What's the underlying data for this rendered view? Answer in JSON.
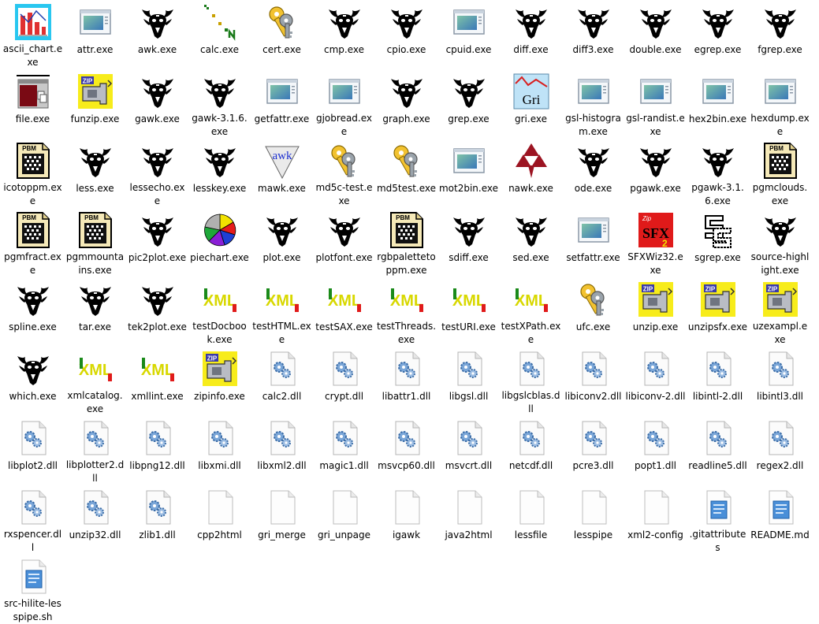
{
  "files": [
    {
      "name": "ascii_chart.exe",
      "icon": "ascii-chart-icon"
    },
    {
      "name": "attr.exe",
      "icon": "app-window-icon"
    },
    {
      "name": "awk.exe",
      "icon": "gnu-icon"
    },
    {
      "name": "calc.exe",
      "icon": "calc-icon"
    },
    {
      "name": "cert.exe",
      "icon": "keys-icon"
    },
    {
      "name": "cmp.exe",
      "icon": "gnu-icon"
    },
    {
      "name": "cpio.exe",
      "icon": "gnu-icon"
    },
    {
      "name": "cpuid.exe",
      "icon": "app-window-icon"
    },
    {
      "name": "diff.exe",
      "icon": "gnu-icon"
    },
    {
      "name": "diff3.exe",
      "icon": "gnu-icon"
    },
    {
      "name": "double.exe",
      "icon": "gnu-icon"
    },
    {
      "name": "egrep.exe",
      "icon": "gnu-icon"
    },
    {
      "name": "fgrep.exe",
      "icon": "gnu-icon"
    },
    {
      "name": "file.exe",
      "icon": "file-tool-icon"
    },
    {
      "name": "funzip.exe",
      "icon": "zip-icon"
    },
    {
      "name": "gawk.exe",
      "icon": "gnu-icon"
    },
    {
      "name": "gawk-3.1.6.exe",
      "icon": "gnu-icon"
    },
    {
      "name": "getfattr.exe",
      "icon": "app-window-icon"
    },
    {
      "name": "gjobread.exe",
      "icon": "app-window-icon"
    },
    {
      "name": "graph.exe",
      "icon": "gnu-icon"
    },
    {
      "name": "grep.exe",
      "icon": "gnu-icon"
    },
    {
      "name": "gri.exe",
      "icon": "gri-icon"
    },
    {
      "name": "gsl-histogram.exe",
      "icon": "app-window-icon"
    },
    {
      "name": "gsl-randist.exe",
      "icon": "app-window-icon"
    },
    {
      "name": "hex2bin.exe",
      "icon": "app-window-icon"
    },
    {
      "name": "hexdump.exe",
      "icon": "app-window-icon"
    },
    {
      "name": "icotoppm.exe",
      "icon": "pbm-icon"
    },
    {
      "name": "less.exe",
      "icon": "gnu-icon"
    },
    {
      "name": "lessecho.exe",
      "icon": "gnu-icon"
    },
    {
      "name": "lesskey.exe",
      "icon": "gnu-icon"
    },
    {
      "name": "mawk.exe",
      "icon": "mawk-icon"
    },
    {
      "name": "md5c-test.exe",
      "icon": "keys-icon"
    },
    {
      "name": "md5test.exe",
      "icon": "keys-icon"
    },
    {
      "name": "mot2bin.exe",
      "icon": "app-window-icon"
    },
    {
      "name": "nawk.exe",
      "icon": "nawk-icon"
    },
    {
      "name": "ode.exe",
      "icon": "gnu-icon"
    },
    {
      "name": "pgawk.exe",
      "icon": "gnu-icon"
    },
    {
      "name": "pgawk-3.1.6.exe",
      "icon": "gnu-icon"
    },
    {
      "name": "pgmclouds.exe",
      "icon": "pbm-icon"
    },
    {
      "name": "pgmfract.exe",
      "icon": "pbm-icon"
    },
    {
      "name": "pgmmountains.exe",
      "icon": "pbm-icon"
    },
    {
      "name": "pic2plot.exe",
      "icon": "gnu-icon"
    },
    {
      "name": "piechart.exe",
      "icon": "piechart-icon"
    },
    {
      "name": "plot.exe",
      "icon": "gnu-icon"
    },
    {
      "name": "plotfont.exe",
      "icon": "gnu-icon"
    },
    {
      "name": "rgbpalettetoppm.exe",
      "icon": "pbm-icon"
    },
    {
      "name": "sdiff.exe",
      "icon": "gnu-icon"
    },
    {
      "name": "sed.exe",
      "icon": "gnu-icon"
    },
    {
      "name": "setfattr.exe",
      "icon": "app-window-icon"
    },
    {
      "name": "SFXWiz32.exe",
      "icon": "sfx-icon"
    },
    {
      "name": "sgrep.exe",
      "icon": "sgrep-icon"
    },
    {
      "name": "source-highlight.exe",
      "icon": "gnu-icon"
    },
    {
      "name": "spline.exe",
      "icon": "gnu-icon"
    },
    {
      "name": "tar.exe",
      "icon": "gnu-icon"
    },
    {
      "name": "tek2plot.exe",
      "icon": "gnu-icon"
    },
    {
      "name": "testDocbook.exe",
      "icon": "xml-icon"
    },
    {
      "name": "testHTML.exe",
      "icon": "xml-icon"
    },
    {
      "name": "testSAX.exe",
      "icon": "xml-icon"
    },
    {
      "name": "testThreads.exe",
      "icon": "xml-icon"
    },
    {
      "name": "testURI.exe",
      "icon": "xml-icon"
    },
    {
      "name": "testXPath.exe",
      "icon": "xml-icon"
    },
    {
      "name": "ufc.exe",
      "icon": "keys-icon"
    },
    {
      "name": "unzip.exe",
      "icon": "zip-icon"
    },
    {
      "name": "unzipsfx.exe",
      "icon": "zip-icon"
    },
    {
      "name": "uzexampl.exe",
      "icon": "zip-icon"
    },
    {
      "name": "which.exe",
      "icon": "gnu-icon"
    },
    {
      "name": "xmlcatalog.exe",
      "icon": "xml-icon"
    },
    {
      "name": "xmllint.exe",
      "icon": "xml-icon"
    },
    {
      "name": "zipinfo.exe",
      "icon": "zip-icon"
    },
    {
      "name": "calc2.dll",
      "icon": "dll-gear-icon"
    },
    {
      "name": "crypt.dll",
      "icon": "dll-gear-icon"
    },
    {
      "name": "libattr1.dll",
      "icon": "dll-gear-icon"
    },
    {
      "name": "libgsl.dll",
      "icon": "dll-gear-icon"
    },
    {
      "name": "libgslcblas.dll",
      "icon": "dll-gear-icon"
    },
    {
      "name": "libiconv2.dll",
      "icon": "dll-gear-icon"
    },
    {
      "name": "libiconv-2.dll",
      "icon": "dll-gear-icon"
    },
    {
      "name": "libintl-2.dll",
      "icon": "dll-gear-icon"
    },
    {
      "name": "libintl3.dll",
      "icon": "dll-gear-icon"
    },
    {
      "name": "libplot2.dll",
      "icon": "dll-gear-icon"
    },
    {
      "name": "libplotter2.dll",
      "icon": "dll-gear-icon"
    },
    {
      "name": "libpng12.dll",
      "icon": "dll-gear-icon"
    },
    {
      "name": "libxmi.dll",
      "icon": "dll-gear-icon"
    },
    {
      "name": "libxml2.dll",
      "icon": "dll-gear-icon"
    },
    {
      "name": "magic1.dll",
      "icon": "dll-gear-icon"
    },
    {
      "name": "msvcp60.dll",
      "icon": "dll-gear-icon"
    },
    {
      "name": "msvcrt.dll",
      "icon": "dll-gear-icon"
    },
    {
      "name": "netcdf.dll",
      "icon": "dll-gear-icon"
    },
    {
      "name": "pcre3.dll",
      "icon": "dll-gear-icon"
    },
    {
      "name": "popt1.dll",
      "icon": "dll-gear-icon"
    },
    {
      "name": "readline5.dll",
      "icon": "dll-gear-icon"
    },
    {
      "name": "regex2.dll",
      "icon": "dll-gear-icon"
    },
    {
      "name": "rxspencer.dll",
      "icon": "dll-gear-icon"
    },
    {
      "name": "unzip32.dll",
      "icon": "dll-gear-icon"
    },
    {
      "name": "zlib1.dll",
      "icon": "dll-gear-icon"
    },
    {
      "name": "cpp2html",
      "icon": "blank-file-icon"
    },
    {
      "name": "gri_merge",
      "icon": "blank-file-icon"
    },
    {
      "name": "gri_unpage",
      "icon": "blank-file-icon"
    },
    {
      "name": "igawk",
      "icon": "blank-file-icon"
    },
    {
      "name": "java2html",
      "icon": "blank-file-icon"
    },
    {
      "name": "lessfile",
      "icon": "blank-file-icon"
    },
    {
      "name": "lesspipe",
      "icon": "blank-file-icon"
    },
    {
      "name": "xml2-config",
      "icon": "blank-file-icon"
    },
    {
      "name": ".gitattributes",
      "icon": "notepad-file-icon"
    },
    {
      "name": "README.md",
      "icon": "notepad-file-icon"
    },
    {
      "name": "src-hilite-lesspipe.sh",
      "icon": "notepad-file-icon"
    }
  ]
}
